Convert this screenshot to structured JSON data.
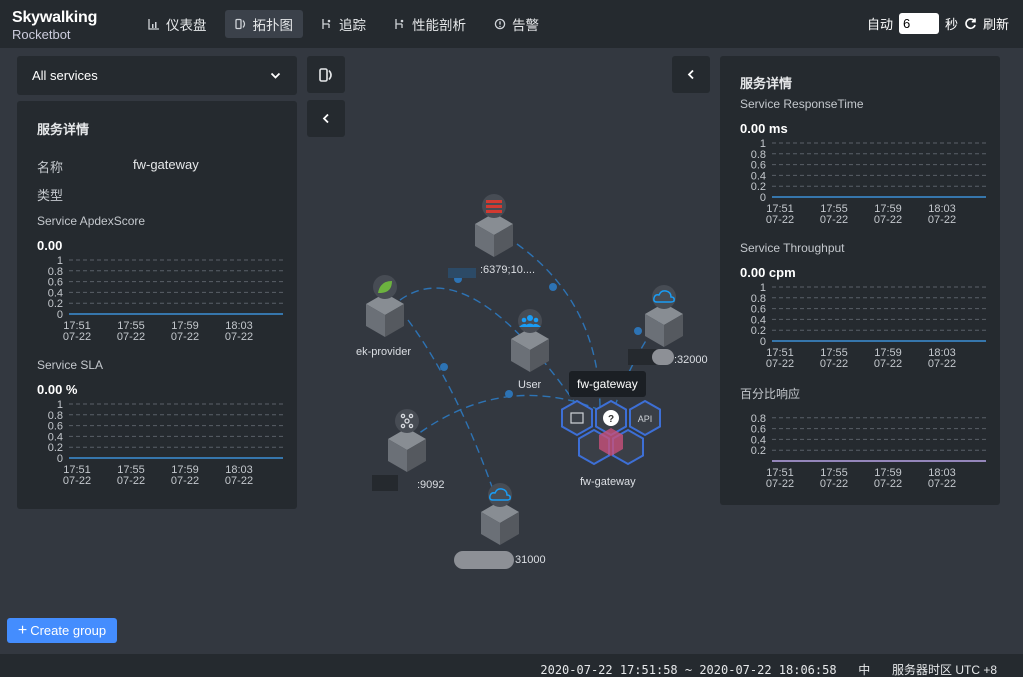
{
  "header": {
    "logo_name": "Skywalking",
    "logo_sub": "Rocketbot",
    "nav": [
      {
        "label": "仪表盘",
        "icon": "dashboard-icon"
      },
      {
        "label": "拓扑图",
        "icon": "topology-icon"
      },
      {
        "label": "追踪",
        "icon": "trace-icon"
      },
      {
        "label": "性能剖析",
        "icon": "profile-icon"
      },
      {
        "label": "告警",
        "icon": "alarm-icon"
      }
    ],
    "auto_label": "自动",
    "auto_value": "6",
    "seconds_label": "秒",
    "refresh_label": "刷新"
  },
  "service_select": {
    "value": "All services"
  },
  "left_panel": {
    "title": "服务详情",
    "name_label": "名称",
    "name_value": "fw-gateway",
    "type_label": "类型",
    "apdex_title": "Service ApdexScore",
    "apdex_value": "0.00",
    "sla_title": "Service SLA",
    "sla_value": "0.00 %"
  },
  "right_panel": {
    "title": "服务详情",
    "resp_title": "Service ResponseTime",
    "resp_value": "0.00 ms",
    "thr_title": "Service Throughput",
    "thr_value": "0.00 cpm",
    "pct_title": "百分比响应"
  },
  "chart_data": [
    {
      "type": "line",
      "title": "Service ApdexScore",
      "x": [
        "17:51\n07-22",
        "17:55\n07-22",
        "17:59\n07-22",
        "18:03\n07-22"
      ],
      "yticks": [
        "0",
        "0.2",
        "0.4",
        "0.6",
        "0.8",
        "1"
      ],
      "ylim": [
        0,
        1
      ],
      "series": [
        {
          "values": [
            0,
            0,
            0,
            0
          ]
        }
      ],
      "grid": true
    },
    {
      "type": "line",
      "title": "Service SLA",
      "x": [
        "17:51\n07-22",
        "17:55\n07-22",
        "17:59\n07-22",
        "18:03\n07-22"
      ],
      "yticks": [
        "0",
        "0.2",
        "0.4",
        "0.6",
        "0.8",
        "1"
      ],
      "ylim": [
        0,
        1
      ],
      "series": [
        {
          "values": [
            0,
            0,
            0,
            0
          ]
        }
      ],
      "grid": true
    },
    {
      "type": "line",
      "title": "Service ResponseTime",
      "x": [
        "17:51\n07-22",
        "17:55\n07-22",
        "17:59\n07-22",
        "18:03\n07-22"
      ],
      "yticks": [
        "0",
        "0.2",
        "0.4",
        "0.6",
        "0.8",
        "1"
      ],
      "ylim": [
        0,
        1
      ],
      "series": [
        {
          "values": [
            0,
            0,
            0,
            0
          ]
        }
      ],
      "grid": true
    },
    {
      "type": "line",
      "title": "Service Throughput",
      "x": [
        "17:51\n07-22",
        "17:55\n07-22",
        "17:59\n07-22",
        "18:03\n07-22"
      ],
      "yticks": [
        "0",
        "0.2",
        "0.4",
        "0.6",
        "0.8",
        "1"
      ],
      "ylim": [
        0,
        1
      ],
      "series": [
        {
          "values": [
            0,
            0,
            0,
            0
          ]
        }
      ],
      "grid": true
    },
    {
      "type": "line",
      "title": "百分比响应",
      "x": [
        "17:51\n07-22",
        "17:55\n07-22",
        "17:59\n07-22",
        "18:03\n07-22"
      ],
      "yticks": [
        "0.2",
        "0.4",
        "0.6",
        "0.8"
      ],
      "ylim": [
        0,
        1
      ],
      "series": [
        {
          "values": [
            0,
            0,
            0,
            0
          ]
        }
      ],
      "grid": true
    }
  ],
  "topology": {
    "nodes": [
      {
        "label": ":6379;10....",
        "icon": "redis-icon",
        "color": "#d33a31"
      },
      {
        "label": "ek-provider",
        "icon": "spring-icon",
        "color": "#6cb33f"
      },
      {
        "label": "User",
        "icon": "user-icon",
        "color": "#1a9cf4"
      },
      {
        "label": ":32000",
        "icon": "cloud-icon",
        "color": "#1a9cf4"
      },
      {
        "label": ":9092",
        "icon": "kafka-icon",
        "color": "#cccccc"
      },
      {
        "label": "31000",
        "icon": "cloud-icon",
        "color": "#1a9cf4"
      },
      {
        "label": "fw-gateway",
        "icon": "unknown-icon",
        "color": "#ffffff"
      }
    ],
    "tooltip": "fw-gateway"
  },
  "create_group": "Create group",
  "footer": {
    "range": "2020-07-22 17:51:58 ~ 2020-07-22 18:06:58",
    "lang": "中",
    "tz": "服务器时区 UTC +8"
  }
}
